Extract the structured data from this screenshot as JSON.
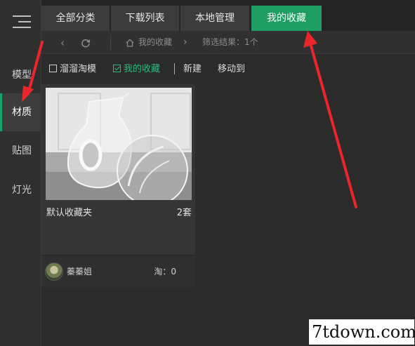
{
  "sidebar": {
    "items": [
      {
        "label": "模型"
      },
      {
        "label": "材质"
      },
      {
        "label": "贴图"
      },
      {
        "label": "灯光"
      }
    ]
  },
  "tabs": [
    {
      "label": "全部分类"
    },
    {
      "label": "下载列表"
    },
    {
      "label": "本地管理"
    },
    {
      "label": "我的收藏"
    }
  ],
  "breadcrumb": {
    "home": "我的收藏",
    "result": "筛选结果：1个"
  },
  "toolbar": {
    "liuliu": "溜溜淘模",
    "favorites": "我的收藏",
    "new": "新建",
    "move_to": "移动到"
  },
  "card": {
    "title": "默认收藏夹",
    "count": "2套",
    "user": "蓁蓁姐",
    "tao": "淘：0"
  },
  "watermark": "7tdown.com",
  "colors": {
    "accent": "#1e9e62",
    "annotation": "#e8262b"
  }
}
